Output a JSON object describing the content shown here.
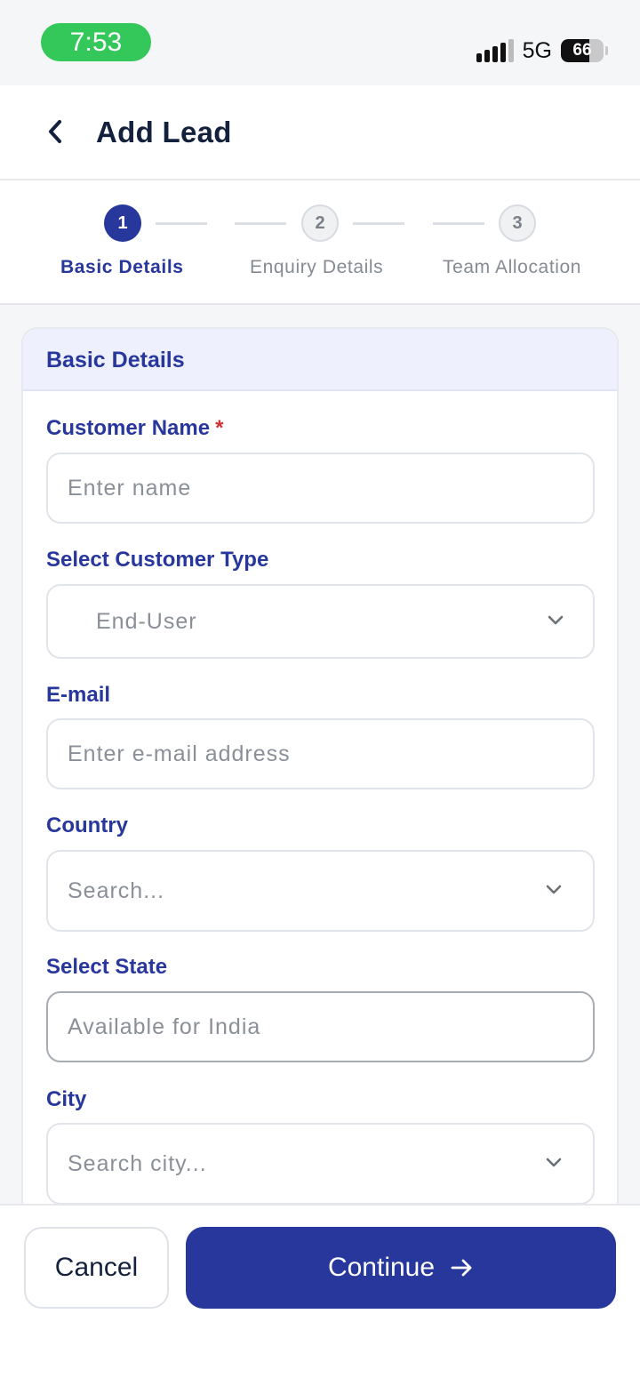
{
  "status_bar": {
    "time": "7:53",
    "network": "5G",
    "battery_percent": 66,
    "battery_label": "66"
  },
  "header": {
    "title": "Add Lead"
  },
  "stepper": {
    "steps": [
      {
        "number": "1",
        "label": "Basic Details",
        "active": true
      },
      {
        "number": "2",
        "label": "Enquiry Details",
        "active": false
      },
      {
        "number": "3",
        "label": "Team Allocation",
        "active": false
      }
    ]
  },
  "form": {
    "section_title": "Basic Details",
    "customer_name": {
      "label": "Customer Name",
      "required_mark": "*",
      "placeholder": "Enter name"
    },
    "customer_type": {
      "label": "Select Customer Type",
      "value": "End-User"
    },
    "email": {
      "label": "E-mail",
      "placeholder": "Enter e-mail address"
    },
    "country": {
      "label": "Country",
      "placeholder": "Search..."
    },
    "state": {
      "label": "Select State",
      "placeholder": "Available for India"
    },
    "city": {
      "label": "City",
      "placeholder": "Search city..."
    }
  },
  "actions": {
    "cancel_label": "Cancel",
    "continue_label": "Continue"
  },
  "colors": {
    "primary": "#27379c",
    "status_green": "#34c759",
    "required": "#d32f2f"
  }
}
